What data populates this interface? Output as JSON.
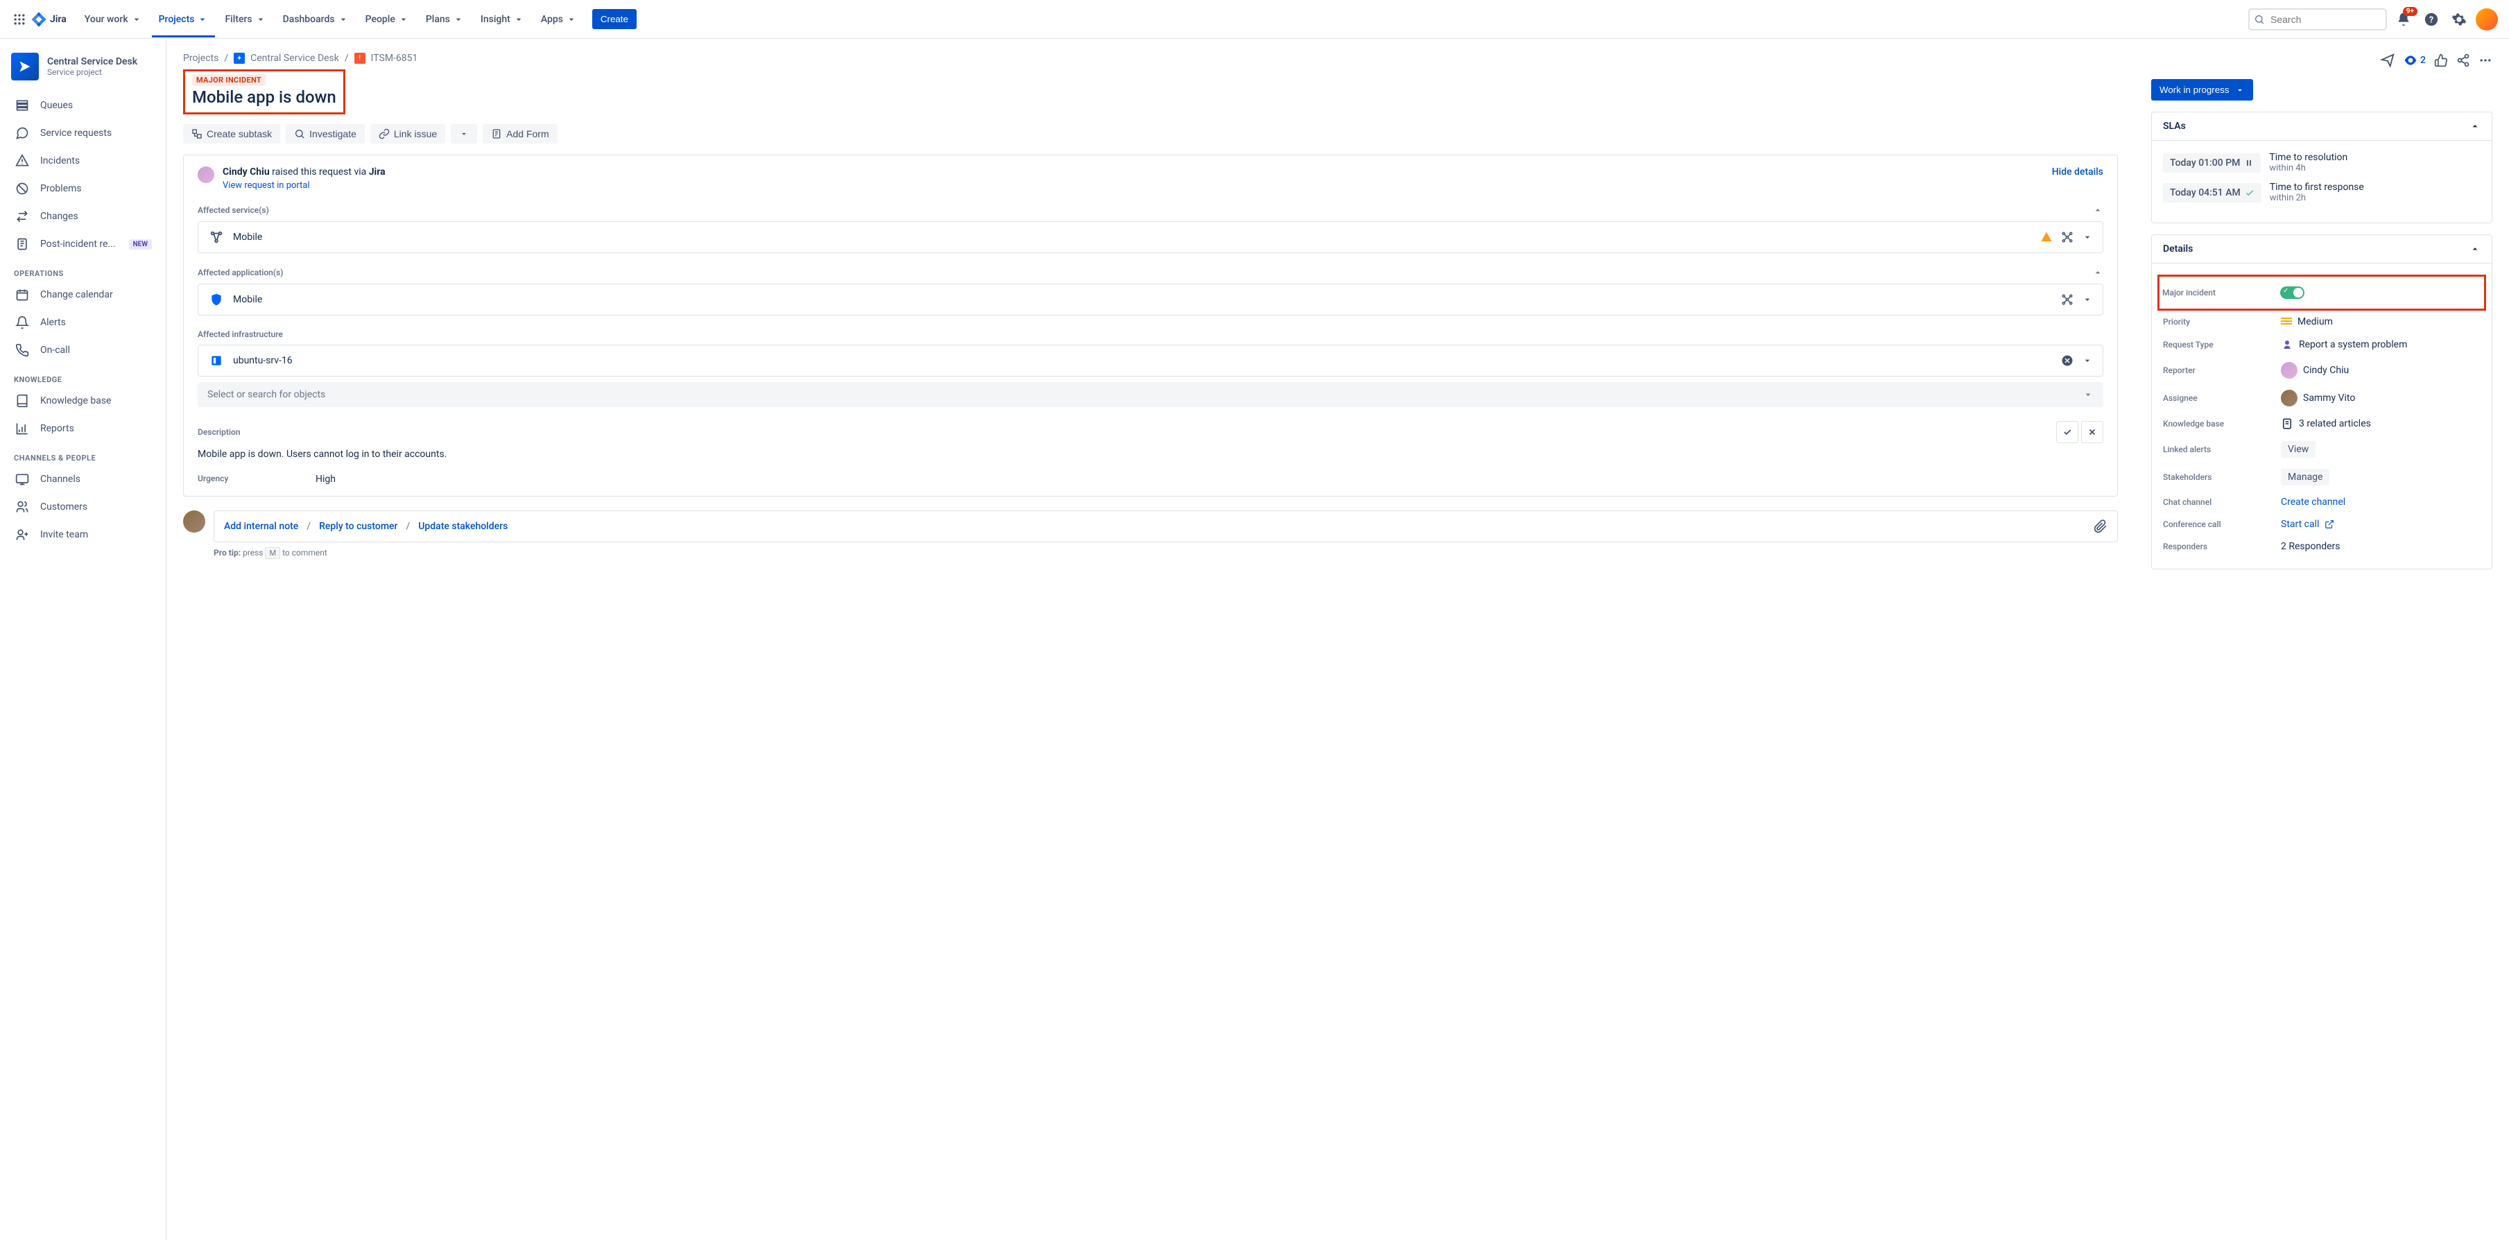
{
  "topnav": {
    "logo": "Jira",
    "items": [
      "Your work",
      "Projects",
      "Filters",
      "Dashboards",
      "People",
      "Plans",
      "Insight",
      "Apps"
    ],
    "create": "Create",
    "search_placeholder": "Search",
    "notif_badge": "9+"
  },
  "sidebar": {
    "project_title": "Central Service Desk",
    "project_sub": "Service project",
    "items": [
      "Queues",
      "Service requests",
      "Incidents",
      "Problems",
      "Changes",
      "Post-incident re..."
    ],
    "new_tag": "NEW",
    "group_ops": "OPERATIONS",
    "ops_items": [
      "Change calendar",
      "Alerts",
      "On-call"
    ],
    "group_knowledge": "KNOWLEDGE",
    "knowledge_items": [
      "Knowledge base",
      "Reports"
    ],
    "group_channels": "CHANNELS & PEOPLE",
    "channels_items": [
      "Channels",
      "Customers",
      "Invite team"
    ]
  },
  "breadcrumb": {
    "projects": "Projects",
    "project": "Central Service Desk",
    "key": "ITSM-6851"
  },
  "issue": {
    "major_tag": "MAJOR INCIDENT",
    "title": "Mobile app is down",
    "actions": {
      "subtask": "Create subtask",
      "investigate": "Investigate",
      "link": "Link issue",
      "form": "Add Form"
    }
  },
  "requester": {
    "name": "Cindy Chiu",
    "text": " raised this request via ",
    "via": "Jira",
    "view_link": "View request in portal",
    "hide": "Hide details"
  },
  "sections": {
    "services_lbl": "Affected service(s)",
    "service_val": "Mobile",
    "apps_lbl": "Affected application(s)",
    "app_val": "Mobile",
    "infra_lbl": "Affected infrastructure",
    "infra_val": "ubuntu-srv-16",
    "search_placeholder": "Select or search for objects",
    "desc_lbl": "Description",
    "desc_text": "Mobile app is down. Users cannot log in to their accounts.",
    "urgency_lbl": "Urgency",
    "urgency_val": "High"
  },
  "comments": {
    "tab1": "Add internal note",
    "tab2": "Reply to customer",
    "tab3": "Update stakeholders",
    "protip_label": "Pro tip:",
    "protip_press": " press ",
    "protip_key": "M",
    "protip_end": " to comment"
  },
  "rightpane": {
    "watchers": "2",
    "status": "Work in progress",
    "slas_head": "SLAs",
    "sla1_time": "Today 01:00 PM",
    "sla1_title": "Time to resolution",
    "sla1_sub": "within 4h",
    "sla2_time": "Today 04:51 AM",
    "sla2_title": "Time to first response",
    "sla2_sub": "within 2h",
    "details_head": "Details",
    "fields": {
      "major": "Major incident",
      "priority": "Priority",
      "priority_val": "Medium",
      "reqtype": "Request Type",
      "reqtype_val": "Report a system problem",
      "reporter": "Reporter",
      "reporter_val": "Cindy Chiu",
      "assignee": "Assignee",
      "assignee_val": "Sammy Vito",
      "kb": "Knowledge base",
      "kb_val": "3 related articles",
      "alerts": "Linked alerts",
      "alerts_val": "View",
      "stakeholders": "Stakeholders",
      "stakeholders_val": "Manage",
      "chat": "Chat channel",
      "chat_val": "Create channel",
      "conf": "Conference call",
      "conf_val": "Start call",
      "responders": "Responders",
      "responders_val": "2 Responders"
    }
  }
}
